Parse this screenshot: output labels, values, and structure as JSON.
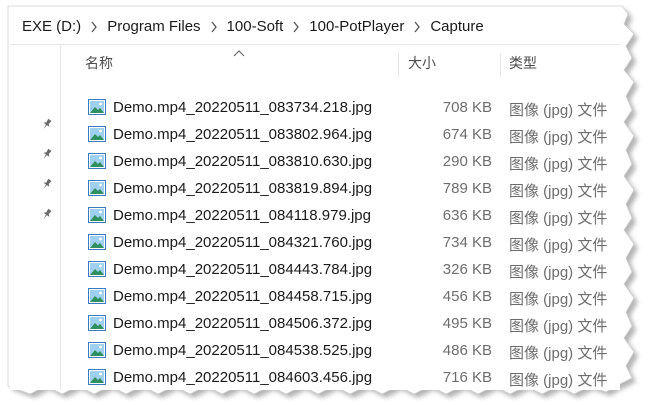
{
  "breadcrumb": [
    "EXE (D:)",
    "Program Files",
    "100-Soft",
    "100-PotPlayer",
    "Capture"
  ],
  "columns": {
    "name": "名称",
    "size": "大小",
    "type": "类型"
  },
  "sort": {
    "column": "name",
    "direction": "ascending"
  },
  "files": [
    {
      "name": "Demo.mp4_20220511_083734.218.jpg",
      "size": "708 KB",
      "type": "图像 (jpg) 文件"
    },
    {
      "name": "Demo.mp4_20220511_083802.964.jpg",
      "size": "674 KB",
      "type": "图像 (jpg) 文件"
    },
    {
      "name": "Demo.mp4_20220511_083810.630.jpg",
      "size": "290 KB",
      "type": "图像 (jpg) 文件"
    },
    {
      "name": "Demo.mp4_20220511_083819.894.jpg",
      "size": "789 KB",
      "type": "图像 (jpg) 文件"
    },
    {
      "name": "Demo.mp4_20220511_084118.979.jpg",
      "size": "636 KB",
      "type": "图像 (jpg) 文件"
    },
    {
      "name": "Demo.mp4_20220511_084321.760.jpg",
      "size": "734 KB",
      "type": "图像 (jpg) 文件"
    },
    {
      "name": "Demo.mp4_20220511_084443.784.jpg",
      "size": "326 KB",
      "type": "图像 (jpg) 文件"
    },
    {
      "name": "Demo.mp4_20220511_084458.715.jpg",
      "size": "456 KB",
      "type": "图像 (jpg) 文件"
    },
    {
      "name": "Demo.mp4_20220511_084506.372.jpg",
      "size": "495 KB",
      "type": "图像 (jpg) 文件"
    },
    {
      "name": "Demo.mp4_20220511_084538.525.jpg",
      "size": "486 KB",
      "type": "图像 (jpg) 文件"
    },
    {
      "name": "Demo.mp4_20220511_084603.456.jpg",
      "size": "716 KB",
      "type": "图像 (jpg) 文件"
    }
  ],
  "icons": {
    "separator": "chevron-right-icon",
    "pin": "pin-icon",
    "file": "jpg-image-file-icon",
    "sort": "sort-ascending-icon"
  }
}
